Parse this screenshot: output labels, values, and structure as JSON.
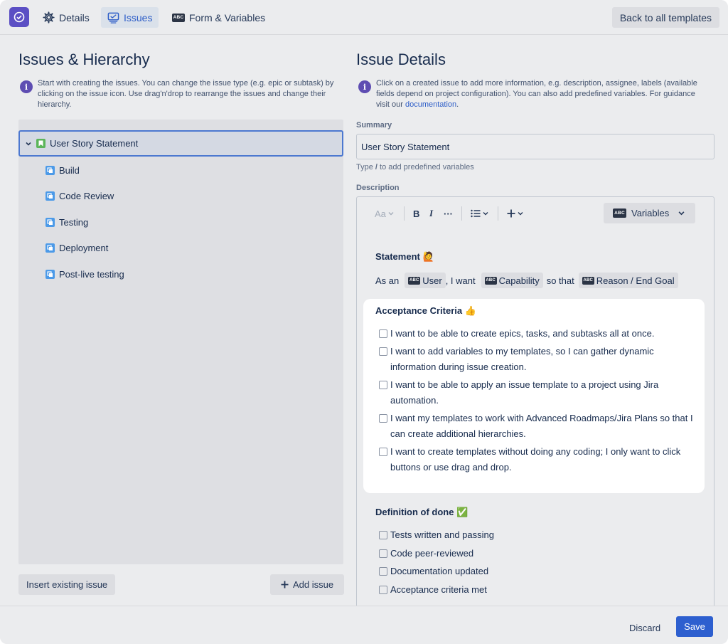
{
  "header": {
    "tabs": [
      {
        "label": "Details",
        "icon": "gear-icon",
        "active": false
      },
      {
        "label": "Issues",
        "icon": "monitor-icon",
        "active": true
      },
      {
        "label": "Form & Variables",
        "icon": "abc-icon",
        "active": false
      }
    ],
    "back_label": "Back to all templates"
  },
  "left": {
    "title": "Issues & Hierarchy",
    "info": "Start with creating the issues. You can change the issue type (e.g. epic or subtask) by clicking on the issue icon. Use drag'n'drop to rearrange the issues and change their hierarchy.",
    "root_issue": "User Story Statement",
    "children": [
      "Build",
      "Code Review",
      "Testing",
      "Deployment",
      "Post-live testing"
    ],
    "insert_label": "Insert existing issue",
    "add_label": "Add issue"
  },
  "right": {
    "title": "Issue Details",
    "info_prefix": "Click on a created issue to add more information, e.g. description, assignee, labels (available fields depend on project configuration). You can also add predefined variables. For guidance visit our",
    "info_link": "documentation",
    "info_suffix": ".",
    "summary_label": "Summary",
    "summary_value": "User Story Statement",
    "hint_prefix": "Type",
    "hint_key": "/",
    "hint_suffix": "to add predefined variables",
    "description_label": "Description",
    "toolbar": {
      "text_style": "Aa",
      "bold": "B",
      "italic": "I",
      "more": "···",
      "variables_label": "Variables",
      "abc": "ABC"
    },
    "statement": {
      "title": "Statement",
      "emoji": "🙋",
      "part1": "As an",
      "var1": "User",
      "part2": ", I want",
      "var2": "Capability",
      "part3": "so that",
      "var3": "Reason / End Goal"
    },
    "acceptance": {
      "title": "Acceptance Criteria",
      "emoji": "👍",
      "items": [
        "I want to be able to create epics, tasks, and subtasks all at once.",
        "I want to add variables to my templates, so I can gather dynamic information during issue creation.",
        "I want to be able to apply an issue template to a project using Jira automation.",
        "I want my templates to work with Advanced Roadmaps/Jira Plans so that I can create additional hierarchies.",
        "I want to create templates without doing any coding; I only want to click buttons or use drag and drop."
      ]
    },
    "done": {
      "title": "Definition of done",
      "emoji": "✅",
      "items": [
        "Tests written and passing",
        "Code peer-reviewed",
        "Documentation updated",
        "Acceptance criteria met"
      ]
    }
  },
  "footer": {
    "discard_label": "Discard",
    "save_label": "Save"
  },
  "colors": {
    "accent": "#2d5fcf",
    "logo": "#5b4fc4",
    "story": "#5bb55a",
    "task": "#4c9ae8"
  }
}
